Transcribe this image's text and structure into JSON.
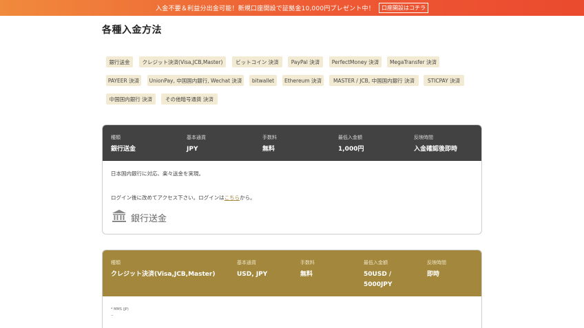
{
  "banner": {
    "message": "入金不要＆利益分出金可能！新規口座開設で証拠金10,000円プレゼント中！",
    "cta": "口座開設はコチラ"
  },
  "page_title": "各種入金方法",
  "methods": [
    "銀行送金",
    "クレジット決済(Visa,JCB,Master)",
    "ビットコイン 決済",
    "PayPal 決済",
    "PerfectMoney 決済",
    "MegaTransfer 決済",
    "PAYEER 決済",
    "UnionPay, 中国国内銀行, Wechat 決済",
    "bitwallet",
    "Ethereum 決済",
    "MASTER / JCB, 中国国内銀行 決済",
    "STICPAY 決済",
    "中国国内銀行 決済",
    "その他暗号通貨 決済"
  ],
  "colors": {
    "banner_start": "#f08a3c",
    "banner_end": "#ea4a2e",
    "chip_bg": "#f2ead2",
    "card1_header": "#424242",
    "card2_header": "#a2873c"
  },
  "card1": {
    "labels": {
      "type": "種類",
      "currency": "基本通貨",
      "fee": "手数料",
      "min": "最低入金額",
      "time": "反映時間"
    },
    "values": {
      "type": "銀行送金",
      "currency": "JPY",
      "fee": "無料",
      "min": "1,000円",
      "time": "入金確認後即時"
    },
    "desc": "日本国内銀行に対応、楽々送金を実現。",
    "login_prefix": "ログイン後に改めてアクセス下さい。ログインは",
    "login_link": "こちら",
    "login_suffix": "から。",
    "logo_text": "銀行送金",
    "logo_icon": "bank-icon"
  },
  "card2": {
    "labels": {
      "type": "種類",
      "currency": "基本通貨",
      "fee": "手数料",
      "min": "最低入金額",
      "time": "反映時間"
    },
    "values": {
      "type": "クレジット決済(Visa,JCB,Master)",
      "currency": "USD, JPY",
      "fee": "無料",
      "min_line1": "50USD /",
      "min_line2": "5000JPY",
      "time": "即時"
    },
    "small_line1": "* MMS (JP)",
    "small_line2": "--"
  }
}
